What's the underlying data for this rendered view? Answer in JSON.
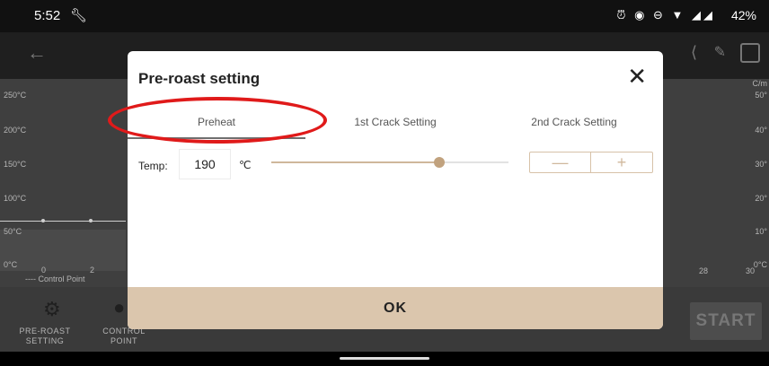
{
  "status_bar": {
    "time": "5:52",
    "battery": "42%"
  },
  "app_bar": {
    "title": "..."
  },
  "chart": {
    "y_left": [
      "250°C",
      "200°C",
      "150°C",
      "100°C",
      "50°C",
      "0°C"
    ],
    "y_right": [
      "C/m",
      "50°",
      "40°",
      "30°",
      "20°",
      "10°",
      "0°C"
    ],
    "x_ticks": [
      "0",
      "2",
      "28",
      "30"
    ],
    "legend": "---- Control Point"
  },
  "toolbar": {
    "pre_roast_label": "PRE-ROAST\nSETTING",
    "control_point_label": "CONTROL\nPOINT",
    "start_label": "START"
  },
  "dialog": {
    "title": "Pre-roast setting",
    "close_glyph": "✕",
    "tabs": [
      {
        "label": "Preheat",
        "selected": true
      },
      {
        "label": "1st Crack Setting",
        "selected": false
      },
      {
        "label": "2nd Crack Setting",
        "selected": false
      }
    ],
    "temp_label": "Temp:",
    "temp_value": "190",
    "temp_unit": "℃",
    "slider_fraction": 0.71,
    "stepper_minus": "—",
    "stepper_plus": "+",
    "ok_label": "OK"
  },
  "colors": {
    "accent": "#dbc6ad",
    "slider": "#c1a27e",
    "annotation": "#e01a1a"
  }
}
